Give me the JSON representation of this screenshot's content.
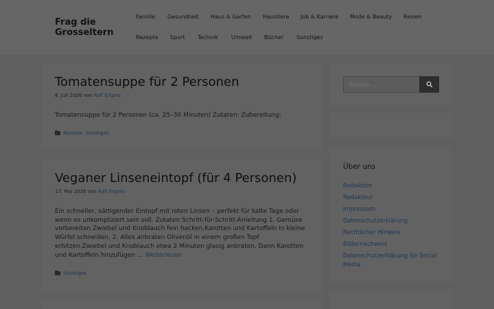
{
  "site": {
    "title": "Frag die Grosseltern"
  },
  "nav": {
    "items": [
      "Familie",
      "Gesundheit",
      "Haus & Garten",
      "Haustiere",
      "Job & Karriere",
      "Mode & Beauty",
      "Reisen",
      "Rezepte",
      "Sport",
      "Technik",
      "Umwelt",
      "Bücher",
      "Sonstiges"
    ]
  },
  "posts": [
    {
      "title": "Tomatensuppe für 2 Personen",
      "date": "8. Juli 2026",
      "by": "von",
      "author": "Ralf Engels",
      "excerpt": "Tomatensuppe für 2 Personen (ca. 25–30 Minuten) Zutaten: Zubereitung:",
      "categories": "Rezepte, Sonstiges"
    },
    {
      "title": "Veganer Linseneintopf (für 4 Personen)",
      "date": "17. Mai 2026",
      "by": "von",
      "author": "Ralf Engels",
      "excerpt": "Ein schneller, sättigender Eintopf mit roten Linsen – perfekt für kalte Tage oder wenn es unkompliziert sein soll. Zutaten Schritt-für-Schritt-Anleitung 1. Gemüse vorbereiten Zwiebel und Knoblauch fein hacken.Karotten und Kartoffeln in kleine Würfel schneiden. 2. Alles anbraten Olivenöl in einem großen Topf erhitzen.Zwiebel und Knoblauch etwa 2 Minuten glasig anbraten. Dann Karotten und Kartoffeln hinzufügen …",
      "read_more": "Weiterlesen",
      "categories": "Sonstiges"
    }
  ],
  "sidebar": {
    "search": {
      "placeholder": "Suchen …"
    },
    "about": {
      "title": "Über uns",
      "links": [
        "Redaktion",
        "Redakteur",
        "Impressum",
        "Datenschutzerklärung",
        "Rechtlicher Hinweis",
        "Bildernachweis",
        "Datenschutzerklärung für Social Media"
      ]
    }
  },
  "colors": {
    "overlay_background": "#5f5f5f",
    "link": "#1f3550",
    "button": "#2d2d2d"
  },
  "icons": {
    "search_button": "search-icon",
    "category": "folder-icon"
  }
}
